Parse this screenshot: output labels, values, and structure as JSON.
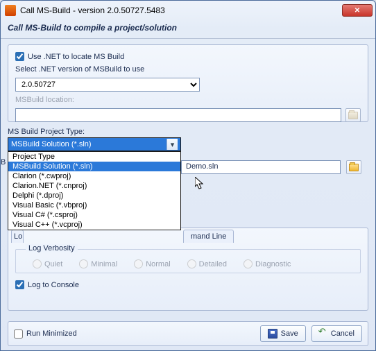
{
  "window": {
    "title": "Call MS-Build - version 2.0.50727.5483",
    "subtitle": "Call MS-Build to compile a project/solution"
  },
  "useDotNet": {
    "label": "Use .NET to locate MS Build",
    "checked": true
  },
  "versionLabel": "Select .NET version of MSBuild to use",
  "versionValue": "2.0.50727",
  "locationLabel": "MSBuild location:",
  "locationValue": "",
  "projectTypeLabel": "MS Build Project Type:",
  "projectTypeSelected": "MSBuild Solution (*.sln)",
  "dropdown": [
    "Project Type",
    "MSBuild Solution (*.sln)",
    "Clarion (*.cwproj)",
    "Clarion.NET (*.cnproj)",
    "Delphi (*.dproj)",
    "Visual Basic (*.vbproj)",
    "Visual C# (*.csproj)",
    "Visual C++ (*.vcproj)"
  ],
  "behind": {
    "buildPrefix": "B",
    "fileValue": "Demo.sln",
    "tabLoggingPrefix": "Lo",
    "tabCmdLabel": "mand Line"
  },
  "logVerbosity": {
    "legend": "Log Verbosity",
    "options": [
      "Quiet",
      "Minimal",
      "Normal",
      "Detailed",
      "Diagnostic"
    ]
  },
  "logToConsole": {
    "label": "Log to Console",
    "checked": true
  },
  "runMinimized": {
    "label": "Run Minimized",
    "checked": false
  },
  "buttons": {
    "save": "Save",
    "cancel": "Cancel"
  }
}
